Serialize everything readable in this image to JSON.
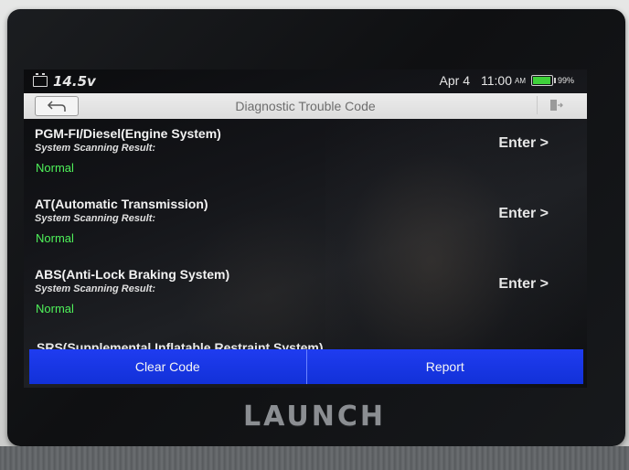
{
  "status_bar": {
    "voltage": "14.5v",
    "date": "Apr 4",
    "time": "11:00",
    "ampm": "AM",
    "battery_percent": "99%",
    "battery_level": 0.99,
    "battery_color": "#3fd13a"
  },
  "header": {
    "title": "Diagnostic Trouble Code",
    "back_icon": "back-arrow-icon",
    "exit_icon": "exit-door-icon"
  },
  "systems": [
    {
      "name": "PGM-FI/Diesel(Engine System)",
      "result_label": "System Scanning Result:",
      "result": "Normal",
      "action": "Enter >"
    },
    {
      "name": "AT(Automatic Transmission)",
      "result_label": "System Scanning Result:",
      "result": "Normal",
      "action": "Enter >"
    },
    {
      "name": "ABS(Anti-Lock Braking System)",
      "result_label": "System Scanning Result:",
      "result": "Normal",
      "action": "Enter >"
    }
  ],
  "partial_item": "SRS(Supplemental Inflatable Restraint System)",
  "footer": {
    "clear_code": "Clear Code",
    "report": "Report"
  },
  "brand": "LAUNCH",
  "colors": {
    "result_ok": "#4ff35a",
    "footer_button": "#1f3cf0"
  }
}
